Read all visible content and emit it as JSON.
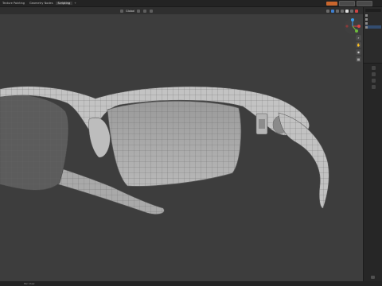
{
  "app": {
    "accent_color": "#c9662d",
    "viewport_bg": "#3d3d3d"
  },
  "topbar": {
    "tabs": [
      {
        "label": "Texture Painting",
        "active": false
      },
      {
        "label": "Geometry Nodes",
        "active": false
      },
      {
        "label": "Scripting",
        "active": true
      },
      {
        "label": "+",
        "active": false
      }
    ]
  },
  "viewport_header": {
    "mode_label": "Global"
  },
  "status_bar": {
    "text": "Pan View"
  },
  "icons": {
    "gizmo": "axis-gizmo-icon",
    "zoom": "zoom-icon",
    "pan": "hand-icon",
    "camera": "camera-icon",
    "perspective": "grid-icon"
  }
}
